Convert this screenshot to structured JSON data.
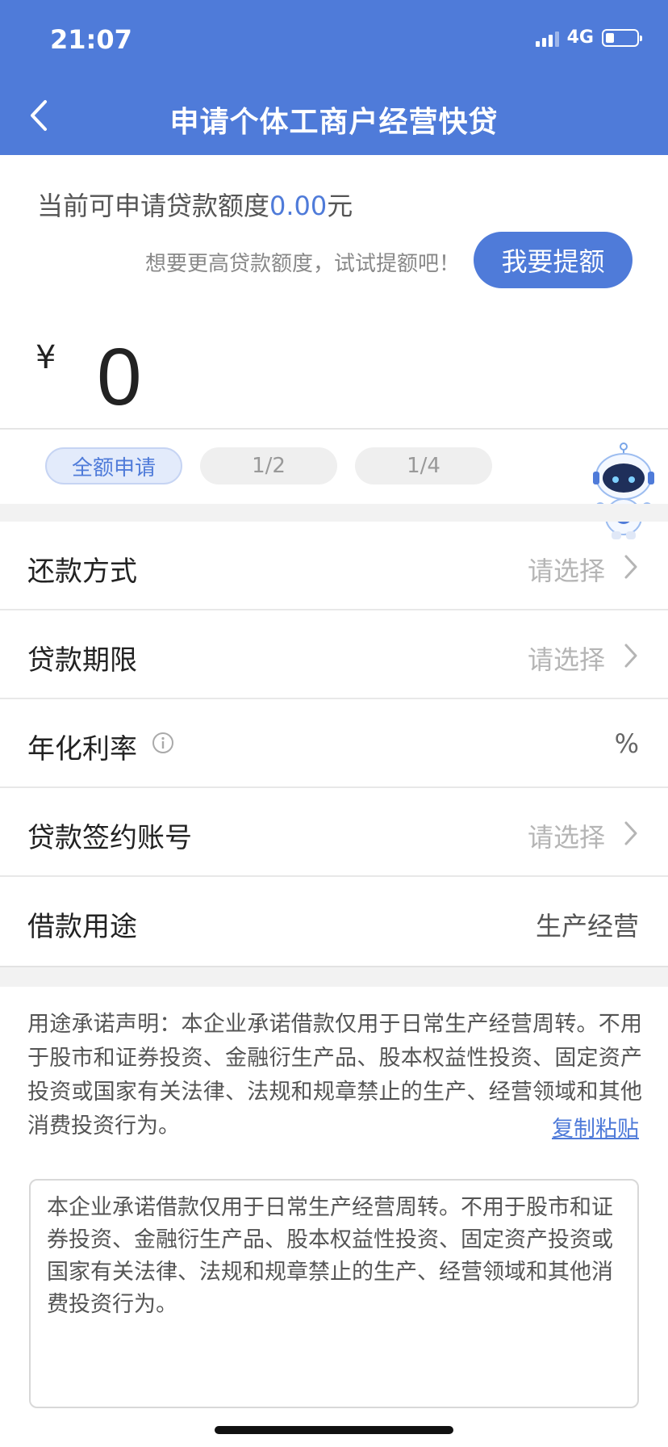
{
  "status_bar": {
    "time": "21:07",
    "network": "4G"
  },
  "header": {
    "title": "申请个体工商户经营快贷"
  },
  "quota": {
    "prefix": "当前可申请贷款额度",
    "amount": "0.00",
    "suffix": "元",
    "raise_tip": "想要更高贷款额度，试试提额吧！",
    "raise_button": "我要提额"
  },
  "amount_input": {
    "currency": "¥",
    "value": "0"
  },
  "ratio_options": [
    {
      "label": "全额申请",
      "active": true
    },
    {
      "label": "1/2",
      "active": false
    },
    {
      "label": "1/4",
      "active": false
    }
  ],
  "form": {
    "repayment": {
      "label": "还款方式",
      "value": "请选择"
    },
    "term": {
      "label": "贷款期限",
      "value": "请选择"
    },
    "rate": {
      "label": "年化利率",
      "value": "%"
    },
    "account": {
      "label": "贷款签约账号",
      "value": "请选择"
    },
    "purpose": {
      "label": "借款用途",
      "value": "生产经营"
    }
  },
  "statement": {
    "text": "用途承诺声明：本企业承诺借款仅用于日常生产经营周转。不用于股市和证券投资、金融衍生产品、股本权益性投资、固定资产投资或国家有关法律、法规和规章禁止的生产、经营领域和其他消费投资行为。",
    "copy_link": "复制粘贴"
  },
  "textbox": {
    "value": "本企业承诺借款仅用于日常生产经营周转。不用于股市和证券投资、金融衍生产品、股本权益性投资、固定资产投资或国家有关法律、法规和规章禁止的生产、经营领域和其他消费投资行为。"
  },
  "colors": {
    "brand": "#4F7BD9",
    "background": "#ffffff",
    "separator": "#f2f2f2"
  },
  "icons": [
    "back-arrow-icon",
    "signal-icon",
    "battery-icon",
    "info-icon",
    "chevron-right-icon",
    "robot-assistant-icon"
  ]
}
